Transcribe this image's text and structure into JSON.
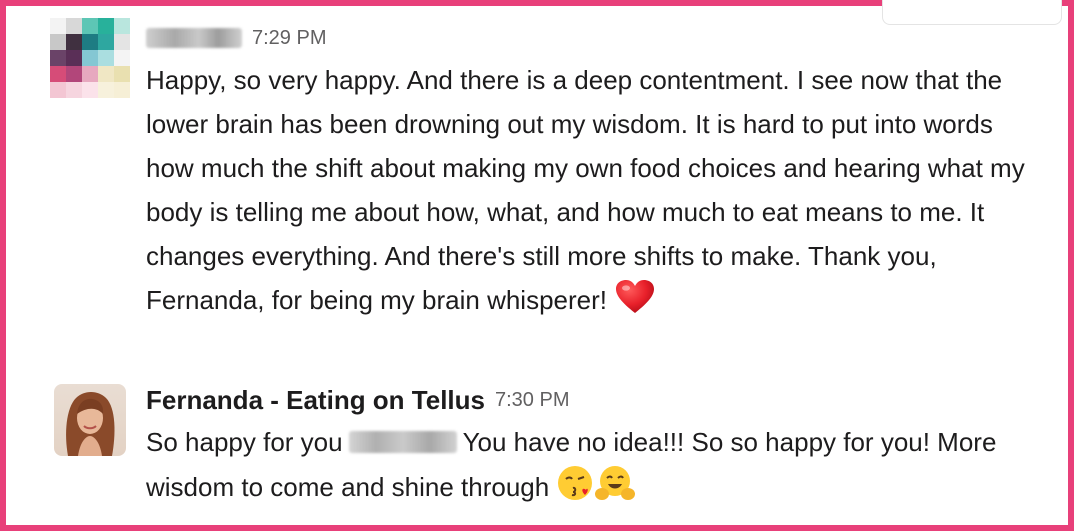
{
  "messages": [
    {
      "sender": "",
      "time": "7:29 PM",
      "text": "Happy, so very happy.  And there is a deep contentment.  I see now that the lower brain has been drowning out my wisdom.  It is hard to put into words how much the shift about making my own food choices and hearing what my body is telling me about how, what, and how much to eat means to me.  It changes everything.  And there's still more shifts to make.  Thank you, Fernanda, for being my brain whisperer!",
      "emoji": "red-heart"
    },
    {
      "sender": "Fernanda - Eating on Tellus",
      "time": "7:30 PM",
      "text_before": "So happy for you",
      "text_after": "You have no idea!!! So so happy for you! More wisdom to come and shine through",
      "emojis": [
        "kissing-face-with-heart",
        "hugging-face"
      ]
    }
  ],
  "colors": {
    "border": "#e8407a",
    "text": "#1d1c1d",
    "timestamp": "#616061"
  }
}
